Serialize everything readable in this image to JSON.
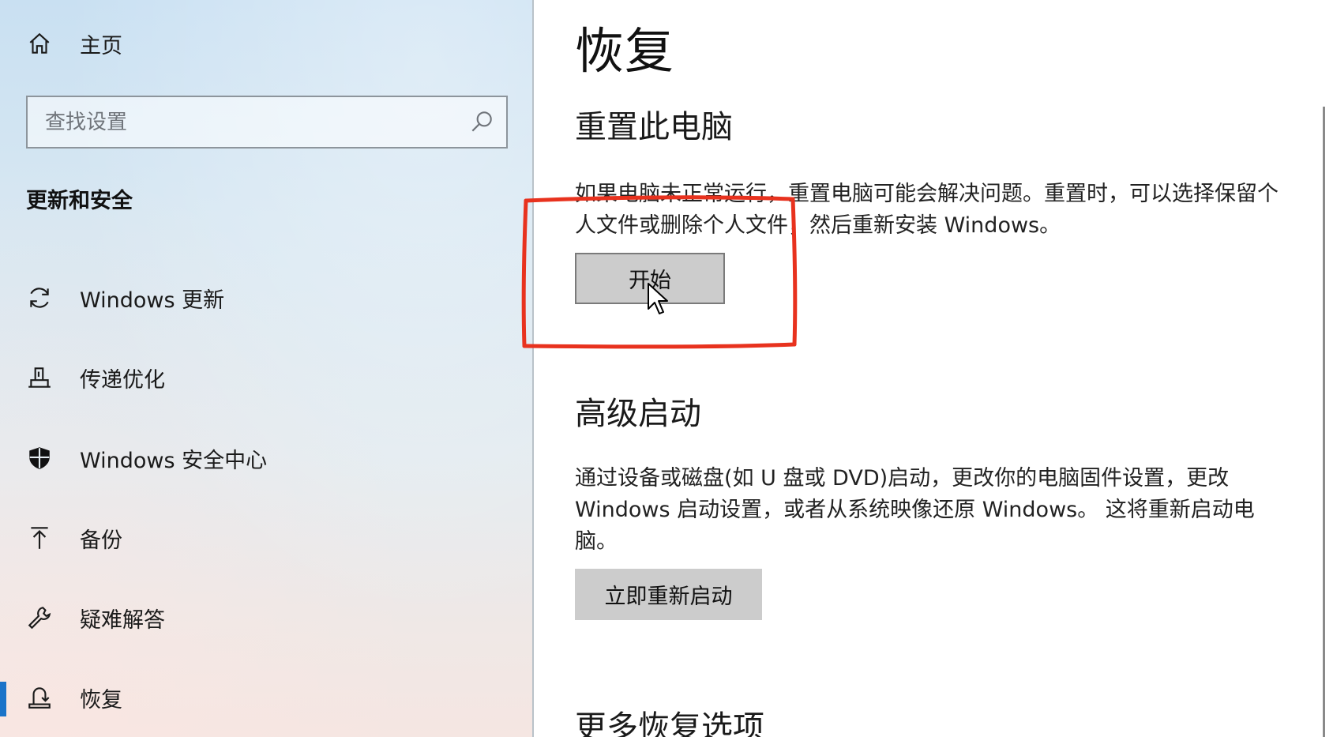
{
  "sidebar": {
    "home_label": "主页",
    "search": {
      "placeholder": "查找设置"
    },
    "section_title": "更新和安全",
    "items": [
      {
        "label": "Windows 更新",
        "icon": "sync-icon"
      },
      {
        "label": "传递优化",
        "icon": "delivery-optimization-icon"
      },
      {
        "label": "Windows 安全中心",
        "icon": "shield-icon"
      },
      {
        "label": "备份",
        "icon": "upload-arrow-icon"
      },
      {
        "label": "疑难解答",
        "icon": "wrench-icon"
      },
      {
        "label": "恢复",
        "icon": "recovery-icon",
        "active": true
      }
    ]
  },
  "main": {
    "title": "恢复",
    "reset": {
      "heading": "重置此电脑",
      "description": "如果电脑未正常运行，重置电脑可能会解决问题。重置时，可以选择保留个人文件或删除个人文件，然后重新安装 Windows。",
      "button_label": "开始"
    },
    "advanced": {
      "heading": "高级启动",
      "description": "通过设备或磁盘(如 U 盘或 DVD)启动，更改你的电脑固件设置，更改 Windows 启动设置，或者从系统映像还原 Windows。 这将重新启动电脑。",
      "button_label": "立即重新启动"
    },
    "more_heading": "更多恢复选项"
  },
  "colors": {
    "accent": "#1a73c9",
    "annotation": "#e8321e",
    "button_bg": "#cccccc"
  }
}
